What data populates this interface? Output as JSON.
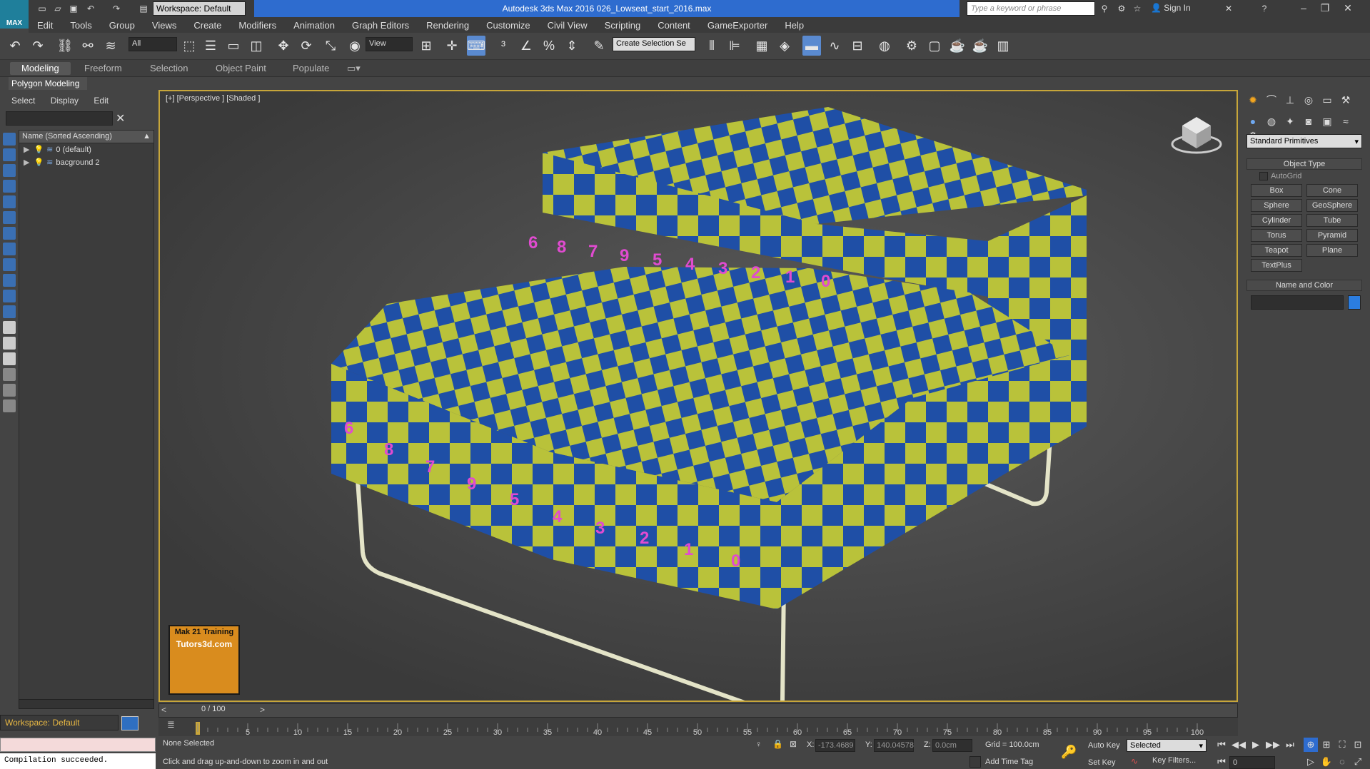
{
  "app": {
    "logo_label": "MAX",
    "title": "Autodesk 3ds Max 2016      026_Lowseat_start_2016.max",
    "workspace": "Workspace: Default",
    "search_placeholder": "Type a keyword or phrase",
    "sign_in": "Sign In"
  },
  "menu": [
    "Edit",
    "Tools",
    "Group",
    "Views",
    "Create",
    "Modifiers",
    "Animation",
    "Graph Editors",
    "Rendering",
    "Customize",
    "Civil View",
    "Scripting",
    "Content",
    "GameExporter",
    "Help"
  ],
  "toolbar": {
    "selection_filter": "All",
    "ref_coord": "View",
    "named_selection": "Create Selection Se"
  },
  "ribbon": {
    "tabs": [
      "Modeling",
      "Freeform",
      "Selection",
      "Object Paint",
      "Populate"
    ],
    "panel": "Polygon Modeling"
  },
  "scene_explorer": {
    "menu": [
      "Select",
      "Display",
      "Edit"
    ],
    "column_header": "Name (Sorted Ascending)",
    "items": [
      "0 (default)",
      "bacground 2"
    ]
  },
  "viewport": {
    "label": "[+] [Perspective ] [Shaded ]",
    "checker_digits": [
      "6",
      "8",
      "7",
      "9",
      "5",
      "4",
      "3",
      "2",
      "1",
      "0"
    ],
    "logo_line1": "Mak 21 Training",
    "logo_line2": "Tutors3d.com"
  },
  "command_panel": {
    "dropdown": "Standard Primitives",
    "object_type_title": "Object Type",
    "autogrid": "AutoGrid",
    "buttons": [
      "Box",
      "Cone",
      "Sphere",
      "GeoSphere",
      "Cylinder",
      "Tube",
      "Torus",
      "Pyramid",
      "Teapot",
      "Plane",
      "TextPlus"
    ],
    "name_color_title": "Name and Color"
  },
  "timeline": {
    "counter": "0 / 100",
    "tick_labels": [
      "5",
      "10",
      "15",
      "20",
      "25",
      "30",
      "35",
      "40",
      "45",
      "50",
      "55",
      "60",
      "65",
      "70",
      "75",
      "80",
      "85",
      "90",
      "95",
      "100"
    ]
  },
  "status": {
    "selection": "None Selected",
    "prompt": "Click and drag up-and-down to zoom in and out",
    "x_label": "X:",
    "x_value": "-173.4689",
    "y_label": "Y:",
    "y_value": "140.04578",
    "z_label": "Z:",
    "z_value": "0.0cm",
    "grid": "Grid = 100.0cm",
    "add_time_tag": "Add Time Tag",
    "auto_key": "Auto Key",
    "set_key": "Set Key",
    "key_mode": "Selected",
    "key_filters": "Key Filters...",
    "frame": "0"
  },
  "bottom": {
    "workspace": "Workspace: Default",
    "maxscript_output": "Compilation succeeded."
  },
  "colors": {
    "accent": "#2e6ccf",
    "checker_yellow": "#b9c23a",
    "checker_blue": "#1f4fa6",
    "checker_digit": "#e04bd0",
    "viewport_border": "#c7a63a"
  }
}
